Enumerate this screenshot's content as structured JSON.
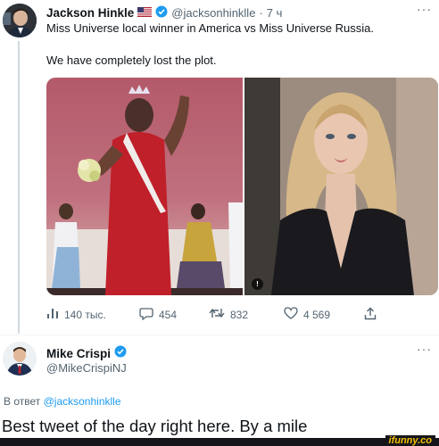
{
  "tweet1": {
    "author_name": "Jackson Hinkle",
    "author_handle": "@jacksonhinklle",
    "separator": "·",
    "time_ago": "7 ч",
    "more": "···",
    "line1": "Miss Universe local winner in America vs Miss Universe Russia.",
    "line2": "We have completely lost the plot.",
    "stats": {
      "views": "140 тыс.",
      "replies": "454",
      "retweets": "832",
      "likes": "4 569"
    }
  },
  "tweet2": {
    "author_name": "Mike Crispi",
    "author_handle": "@MikeCrispiNJ",
    "more": "···",
    "reply_prefix": "В ответ",
    "reply_handle": "@jacksonhinklle",
    "text": "Best tweet of the day right here. By a mile"
  },
  "watermark": "ifunny.co",
  "colors": {
    "accent": "#1d9bf0",
    "muted": "#536471",
    "text": "#0f1419",
    "watermark": "#f6c000"
  },
  "icons": [
    "flag-icon",
    "verified-icon",
    "views-icon",
    "reply-icon",
    "retweet-icon",
    "like-icon",
    "share-icon"
  ]
}
